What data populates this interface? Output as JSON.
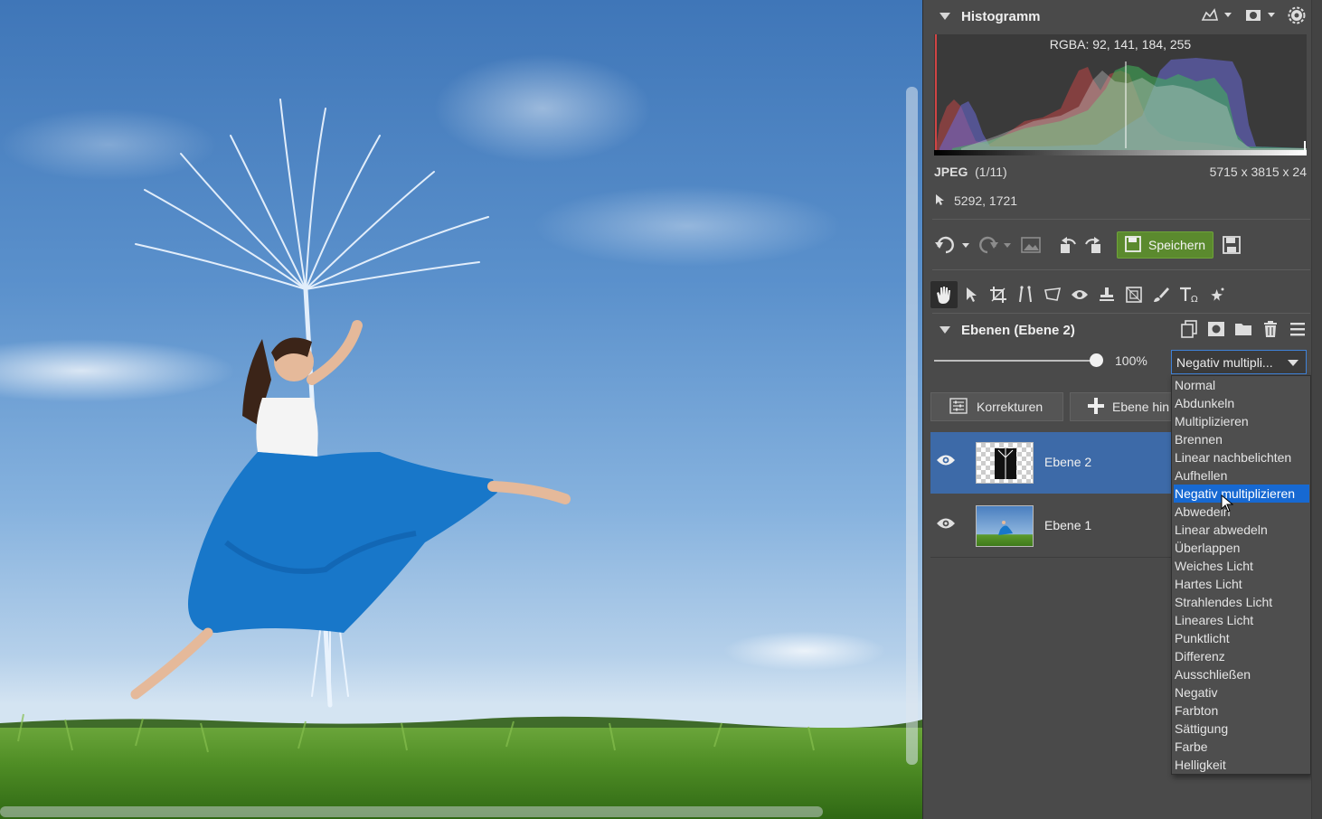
{
  "histogram": {
    "title": "Histogramm",
    "rgba_readout": "RGBA:  92, 141, 184, 255"
  },
  "image_info": {
    "format": "JPEG",
    "index": "(1/11)",
    "dimensions": "5715 x 3815 x 24",
    "cursor_coords": "5292, 1721"
  },
  "toolbar": {
    "save_label": "Speichern"
  },
  "layers": {
    "title": "Ebenen (Ebene 2)",
    "opacity": "100%",
    "opacity_fraction": 1.0,
    "blend_mode": "Negativ multipli...",
    "corrections_label": "Korrekturen",
    "add_layer_label": "Ebene hin",
    "items": [
      {
        "name": "Ebene 2",
        "selected": true
      },
      {
        "name": "Ebene 1",
        "selected": false
      }
    ]
  },
  "blend_menu": {
    "selected": "Negativ multiplizieren",
    "options": [
      "Normal",
      "Abdunkeln",
      "Multiplizieren",
      "Brennen",
      "Linear nachbelichten",
      "Aufhellen",
      "Negativ multiplizieren",
      "Abwedeln",
      "Linear abwedeln",
      "Überlappen",
      "Weiches Licht",
      "Hartes Licht",
      "Strahlendes Licht",
      "Lineares Licht",
      "Punktlicht",
      "Differenz",
      "Ausschließen",
      "Negativ",
      "Farbton",
      "Sättigung",
      "Farbe",
      "Helligkeit"
    ]
  },
  "colors": {
    "accent": "#1769d2",
    "selected_layer": "#3d6aa8",
    "save_green": "#5b8a2e",
    "panel_bg": "#4a4a4a"
  }
}
